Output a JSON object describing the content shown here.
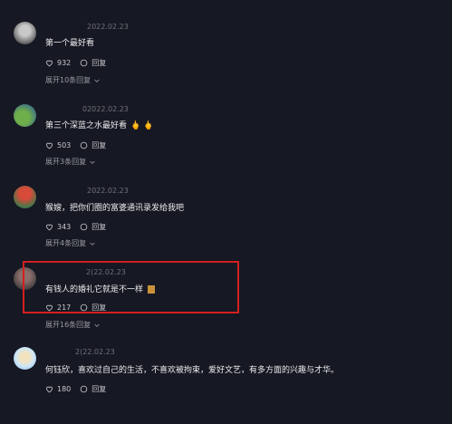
{
  "comments": [
    {
      "date": "2022.02.23",
      "text": "第一个最好看",
      "likes": "932",
      "reply": "回复",
      "expand": "展开10条回复"
    },
    {
      "date": "02022.02.23",
      "text": "第三个深蓝之水最好看",
      "text_extra": "🖕 🖕",
      "likes": "503",
      "reply": "回复",
      "expand": "展开3条回复"
    },
    {
      "date": "2022.02.23",
      "text": "猴嫂，把你们圈的富婆通讯录发给我吧",
      "likes": "343",
      "reply": "回复",
      "expand": "展开4条回复"
    },
    {
      "date": "2(22.02.23",
      "text": "有钱人的婚礼它就是不一样",
      "likes": "217",
      "reply": "回复",
      "expand": "展开16条回复"
    },
    {
      "date": "2(22.02.23",
      "text": "何钰欣，喜欢过自己的生活，不喜欢被拘束，爱好文艺，有多方面的兴趣与才华。",
      "likes": "180",
      "reply": "回复"
    }
  ],
  "colors": {
    "background": "#161823",
    "highlight_border": "#d41f1f"
  }
}
